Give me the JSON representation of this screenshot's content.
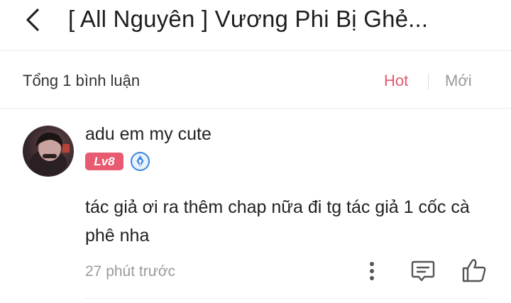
{
  "header": {
    "title": "[ All Nguyên ] Vương Phi Bị Ghẻ...",
    "back_icon": "chevron-left-icon"
  },
  "comments_bar": {
    "total_label": "Tổng 1 bình luận",
    "sort_hot": "Hot",
    "sort_new": "Mới",
    "active_sort": "Hot",
    "colors": {
      "active": "#e35b6e",
      "inactive": "#9a9a9a"
    }
  },
  "comment": {
    "username": "adu em my cute",
    "level_badge": "Lv8",
    "author_badge_icon": "pen-nib-icon",
    "text": "tác giả ơi ra thêm chap nữa đi tg tác giả 1 cốc cà phê nha",
    "time": "27 phút trước",
    "actions": {
      "more_icon": "more-vertical-icon",
      "reply_icon": "comment-icon",
      "like_icon": "thumbs-up-icon"
    },
    "colors": {
      "level_badge": "#e85a70",
      "author_badge": "#3a86e0"
    }
  }
}
